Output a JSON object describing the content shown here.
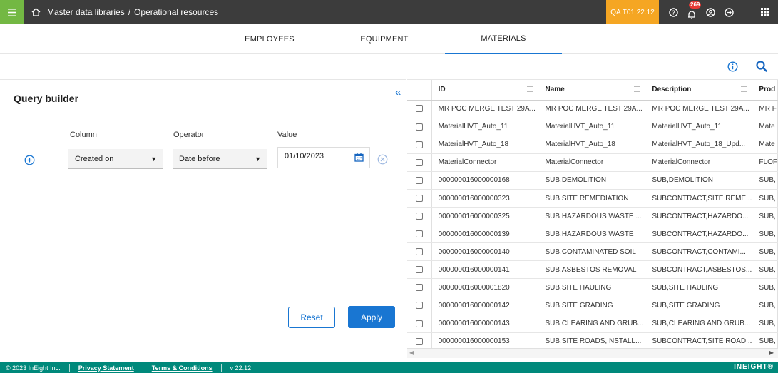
{
  "header": {
    "breadcrumb": [
      "Master data libraries",
      "/",
      "Operational resources"
    ],
    "environment": "QA T01 22.12",
    "notification_count": "269",
    "accent": "#73b843",
    "badge_color": "#f5a623"
  },
  "tabs": [
    {
      "label": "EMPLOYEES"
    },
    {
      "label": "EQUIPMENT"
    },
    {
      "label": "MATERIALS",
      "active": true
    }
  ],
  "query_builder": {
    "title": "Query builder",
    "labels": {
      "column": "Column",
      "operator": "Operator",
      "value": "Value"
    },
    "column_value": "Created on",
    "operator_value": "Date before",
    "date_value": "01/10/2023",
    "reset_label": "Reset",
    "apply_label": "Apply"
  },
  "grid": {
    "columns": [
      "ID",
      "Name",
      "Description",
      "Prod"
    ],
    "rows": [
      [
        "MR POC MERGE TEST 29A...",
        "MR POC MERGE TEST 29A...",
        "MR POC MERGE TEST 29A...",
        "MR F"
      ],
      [
        "MaterialHVT_Auto_11",
        "MaterialHVT_Auto_11",
        "MaterialHVT_Auto_11",
        "Mate"
      ],
      [
        "MaterialHVT_Auto_18",
        "MaterialHVT_Auto_18",
        "MaterialHVT_Auto_18_Upd...",
        "Mate"
      ],
      [
        "MaterialConnector",
        "MaterialConnector",
        "MaterialConnector",
        "FLOF"
      ],
      [
        "000000016000000168",
        "SUB,DEMOLITION",
        "SUB,DEMOLITION",
        "SUB,"
      ],
      [
        "000000016000000323",
        "SUB,SITE REMEDIATION",
        "SUBCONTRACT,SITE REME...",
        "SUB,"
      ],
      [
        "000000016000000325",
        "SUB,HAZARDOUS WASTE ...",
        "SUBCONTRACT,HAZARDO...",
        "SUB,"
      ],
      [
        "000000016000000139",
        "SUB,HAZARDOUS WASTE",
        "SUBCONTRACT,HAZARDO...",
        "SUB,"
      ],
      [
        "000000016000000140",
        "SUB,CONTAMINATED SOIL",
        "SUBCONTRACT,CONTAMI...",
        "SUB,"
      ],
      [
        "000000016000000141",
        "SUB,ASBESTOS REMOVAL",
        "SUBCONTRACT,ASBESTOS...",
        "SUB,"
      ],
      [
        "000000016000001820",
        "SUB,SITE HAULING",
        "SUB,SITE HAULING",
        "SUB,"
      ],
      [
        "000000016000000142",
        "SUB,SITE GRADING",
        "SUB,SITE GRADING",
        "SUB,"
      ],
      [
        "000000016000000143",
        "SUB,CLEARING AND GRUB...",
        "SUB,CLEARING AND GRUB...",
        "SUB,"
      ],
      [
        "000000016000000153",
        "SUB,SITE ROADS,INSTALL...",
        "SUBCONTRACT,SITE ROAD...",
        "SUB,"
      ]
    ]
  },
  "footer": {
    "copyright": "© 2023 InEight Inc.",
    "privacy": "Privacy Statement",
    "terms": "Terms & Conditions",
    "version": "v 22.12",
    "brand": "INEIGHT",
    "color": "#00897b"
  }
}
